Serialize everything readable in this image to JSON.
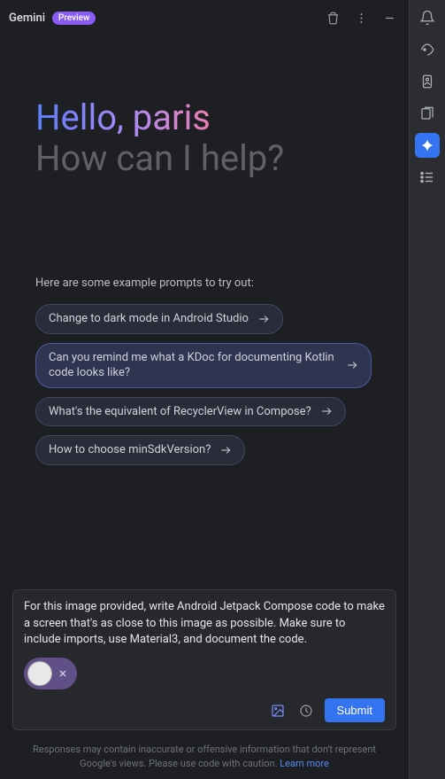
{
  "header": {
    "title": "Gemini",
    "badge": "Preview"
  },
  "greeting": {
    "hello": "Hello, paris",
    "help": "How can I help?"
  },
  "examples": {
    "label": "Here are some example prompts to try out:",
    "items": [
      "Change to dark mode in Android Studio",
      "Can you remind me what a KDoc for documenting Kotlin code looks like?",
      "What's the equivalent of RecyclerView in Compose?",
      "How to choose minSdkVersion?"
    ]
  },
  "input": {
    "text": "For this image provided, write Android Jetpack Compose code to make a screen that's as close to this image as possible. Make sure to include imports, use Material3, and document the code.",
    "submit": "Submit"
  },
  "disclaimer": {
    "text": "Responses may contain inaccurate or offensive information that don't represent Google's views. Please use code with caution. ",
    "link": "Learn more"
  }
}
